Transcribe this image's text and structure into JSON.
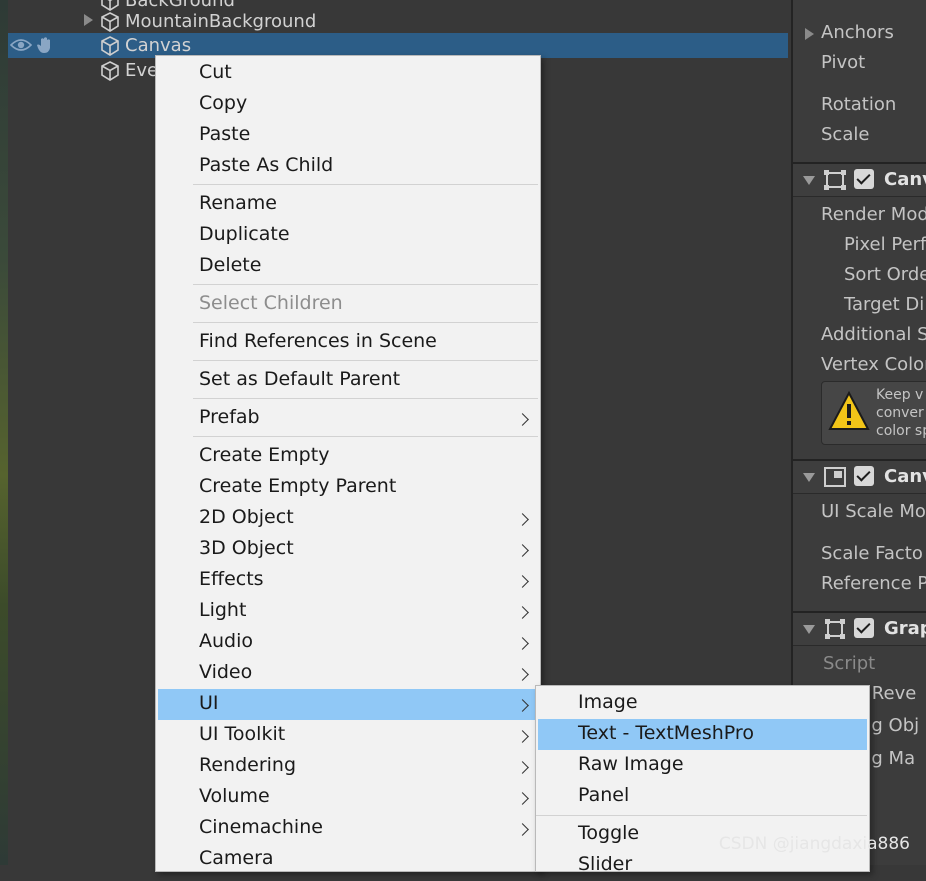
{
  "hierarchy": {
    "items": [
      {
        "label": "BackGround",
        "has_children": false,
        "selected": false
      },
      {
        "label": "MountainBackground",
        "has_children": true,
        "selected": false
      },
      {
        "label": "Canvas",
        "has_children": false,
        "selected": true
      },
      {
        "label": "Eve",
        "has_children": false,
        "selected": false
      }
    ]
  },
  "inspector": {
    "rows": [
      "Anchors",
      "Pivot",
      "Rotation",
      "Scale"
    ],
    "canvas_header": "Canv",
    "canvas_rows": [
      "Render Mod",
      "Pixel Perf",
      "Sort Orde",
      "Target Di",
      "Additional S",
      "Vertex Color"
    ],
    "warning_lines": [
      "Keep v",
      "conver",
      "color sp"
    ],
    "scaler_header": "Canv",
    "scaler_rows": [
      "UI Scale Mo",
      "Scale Facto",
      "Reference P"
    ],
    "raycaster_header": "Grap",
    "raycaster_rows": [
      "Script",
      "e Reve",
      "ing Obj",
      "ing Ma"
    ]
  },
  "context_menu": {
    "groups": [
      [
        {
          "label": "Cut"
        },
        {
          "label": "Copy"
        },
        {
          "label": "Paste"
        },
        {
          "label": "Paste As Child"
        }
      ],
      [
        {
          "label": "Rename"
        },
        {
          "label": "Duplicate"
        },
        {
          "label": "Delete"
        }
      ],
      [
        {
          "label": "Select Children",
          "disabled": true
        }
      ],
      [
        {
          "label": "Find References in Scene"
        }
      ],
      [
        {
          "label": "Set as Default Parent"
        }
      ],
      [
        {
          "label": "Prefab",
          "submenu": true
        }
      ],
      [
        {
          "label": "Create Empty"
        },
        {
          "label": "Create Empty Parent"
        },
        {
          "label": "2D Object",
          "submenu": true
        },
        {
          "label": "3D Object",
          "submenu": true
        },
        {
          "label": "Effects",
          "submenu": true
        },
        {
          "label": "Light",
          "submenu": true
        },
        {
          "label": "Audio",
          "submenu": true
        },
        {
          "label": "Video",
          "submenu": true
        },
        {
          "label": "UI",
          "submenu": true,
          "highlighted": true
        },
        {
          "label": "UI Toolkit",
          "submenu": true
        },
        {
          "label": "Rendering",
          "submenu": true
        },
        {
          "label": "Volume",
          "submenu": true
        },
        {
          "label": "Cinemachine",
          "submenu": true
        },
        {
          "label": "Camera"
        }
      ]
    ]
  },
  "ui_submenu": {
    "groups": [
      [
        {
          "label": "Image"
        },
        {
          "label": "Text - TextMeshPro",
          "highlighted": true
        },
        {
          "label": "Raw Image"
        },
        {
          "label": "Panel"
        }
      ],
      [
        {
          "label": "Toggle"
        },
        {
          "label": "Slider"
        }
      ]
    ]
  },
  "watermark": "CSDN @jiangdaxia886",
  "colors": {
    "selection": "#2c5d87",
    "menu_highlight": "#90c8f6",
    "menu_bg": "#f2f2f2",
    "panel_bg": "#383838"
  },
  "icons": [
    "eye-icon",
    "hand-icon",
    "cube-icon",
    "warning-icon",
    "checkbox-icon",
    "submenu-arrow-icon"
  ]
}
